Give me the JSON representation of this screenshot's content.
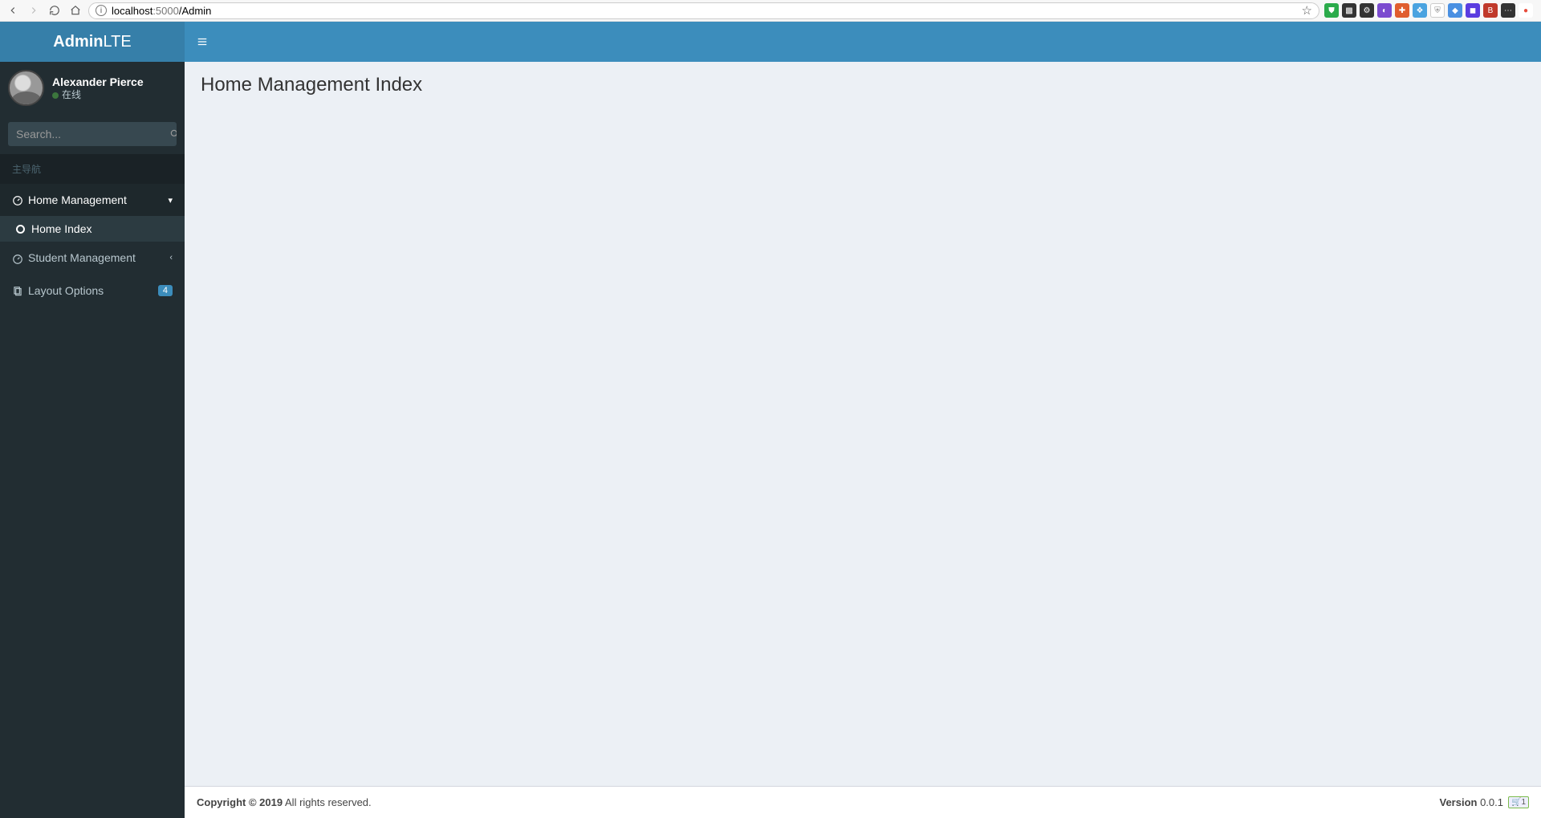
{
  "browser": {
    "url_host": "localhost",
    "url_port": ":5000",
    "url_path": "/Admin"
  },
  "app": {
    "logo_bold": "Admin",
    "logo_light": "LTE"
  },
  "user": {
    "name": "Alexander Pierce",
    "status_text": "在线"
  },
  "search": {
    "placeholder": "Search..."
  },
  "nav": {
    "header": "主导航",
    "items": [
      {
        "icon": "dashboard",
        "label": "Home Management",
        "arrow": "down",
        "active": true
      },
      {
        "icon": "dashboard",
        "label": "Student Management",
        "arrow": "left",
        "active": false
      },
      {
        "icon": "files",
        "label": "Layout Options",
        "badge": "4"
      }
    ],
    "submenu": [
      {
        "label": "Home Index",
        "active": true
      }
    ]
  },
  "page": {
    "title": "Home Management Index"
  },
  "footer": {
    "copyright_bold": "Copyright © 2019",
    "copyright_rest": " All rights reserved.",
    "version_label": "Version",
    "version_value": " 0.0.1",
    "badge": "1"
  },
  "ext_colors": [
    "#2bab4b",
    "#333",
    "#333",
    "#7b4bcf",
    "#e05d2e",
    "#4aa3e0",
    "#999",
    "#4a90e2",
    "#5a3de0",
    "#c0392b",
    "#333",
    "#e74c3c"
  ]
}
